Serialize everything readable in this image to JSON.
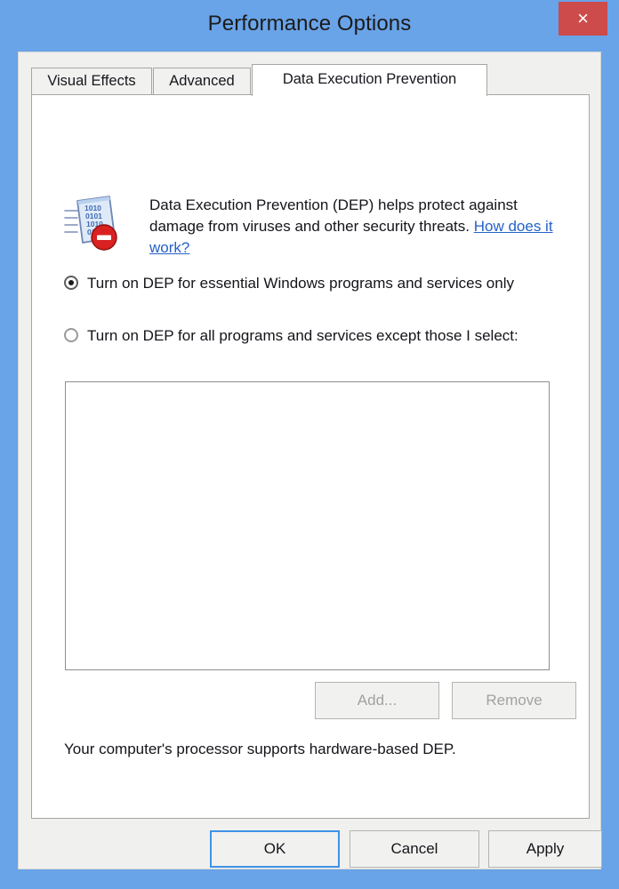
{
  "window": {
    "title": "Performance Options",
    "close_label": "×",
    "titlebar_color": "#69a3e8",
    "close_button_color": "#cd4b4b"
  },
  "tabs": [
    {
      "label": "Visual Effects",
      "active": false
    },
    {
      "label": "Advanced",
      "active": false
    },
    {
      "label": "Data Execution Prevention",
      "active": true
    }
  ],
  "info": {
    "icon": "dep-shield-icon",
    "text_part1": "Data Execution Prevention (DEP) helps protect against damage from viruses and other security threats. ",
    "link_text": "How does it work?",
    "link_color": "#2662c8"
  },
  "options": [
    {
      "label": "Turn on DEP for essential Windows programs and services only",
      "selected": true
    },
    {
      "label": "Turn on DEP for all programs and services except those I select:",
      "selected": false
    }
  ],
  "exception_list": {
    "items": []
  },
  "list_buttons": {
    "add_label": "Add...",
    "add_enabled": false,
    "remove_label": "Remove",
    "remove_enabled": false
  },
  "status": {
    "text": "Your computer's processor supports hardware-based DEP."
  },
  "footer": {
    "ok_label": "OK",
    "cancel_label": "Cancel",
    "apply_label": "Apply",
    "default_button": "OK",
    "focus_color": "#3f93e8"
  }
}
